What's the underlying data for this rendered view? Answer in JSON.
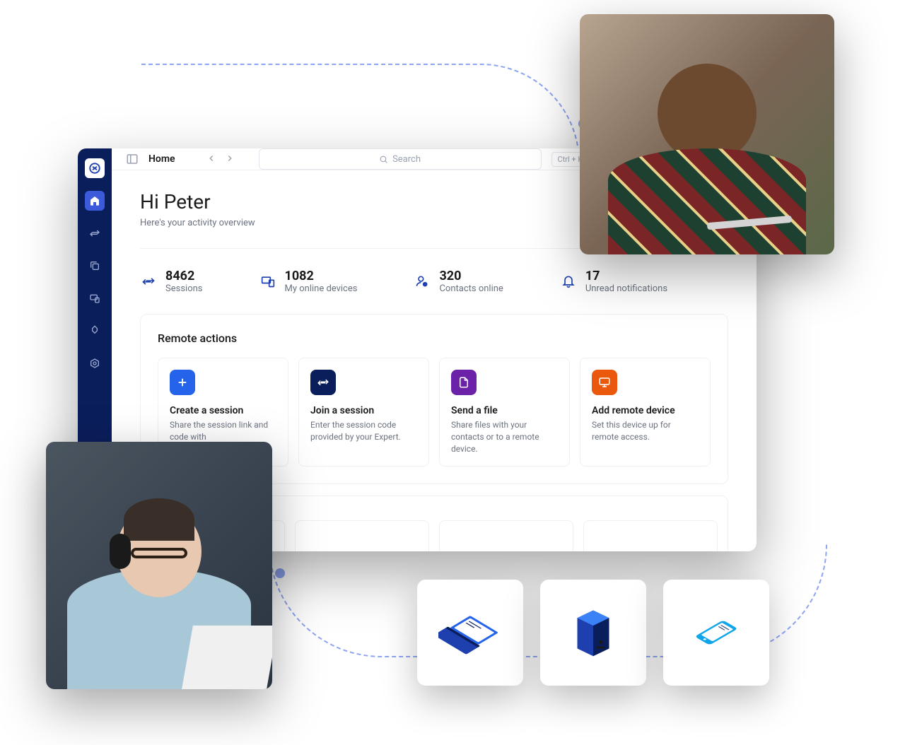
{
  "breadcrumb": "Home",
  "search": {
    "placeholder": "Search",
    "shortcut": "Ctrl + K"
  },
  "greeting": "Hi Peter",
  "subtitle": "Here's your activity overview",
  "stats": {
    "sessions": {
      "value": "8462",
      "label": "Sessions"
    },
    "devices": {
      "value": "1082",
      "label": "My online devices"
    },
    "contacts": {
      "value": "320",
      "label": "Contacts online"
    },
    "notifications": {
      "value": "17",
      "label": "Unread notifications"
    }
  },
  "section_title": "Remote actions",
  "actions": {
    "create": {
      "title": "Create a session",
      "desc": "Share the session link and code with"
    },
    "join": {
      "title": "Join a session",
      "desc": "Enter the session code provided by your Expert."
    },
    "send": {
      "title": "Send a file",
      "desc": "Share files with your contacts or to a remote device."
    },
    "add": {
      "title": "Add remote device",
      "desc": "Set this device up for remote access."
    }
  }
}
